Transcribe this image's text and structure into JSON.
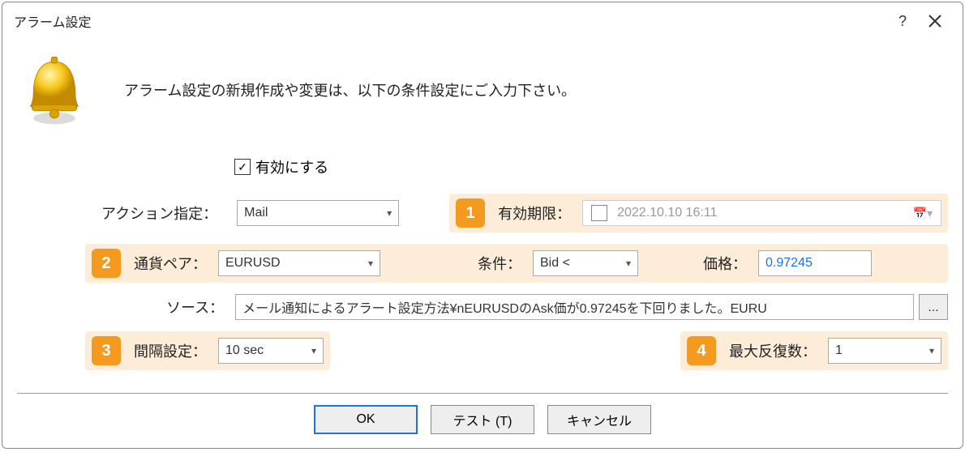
{
  "window": {
    "title": "アラーム設定"
  },
  "intro": "アラーム設定の新規作成や変更は、以下の条件設定にご入力下さい。",
  "enable": {
    "label": "有効にする",
    "checked": true
  },
  "steps": {
    "s1": "1",
    "s2": "2",
    "s3": "3",
    "s4": "4"
  },
  "action": {
    "label": "アクション指定：",
    "value": "Mail"
  },
  "expiry": {
    "label": "有効期限：",
    "value": "2022.10.10 16:11"
  },
  "pair": {
    "label": "通貨ペア：",
    "value": "EURUSD"
  },
  "condition": {
    "label": "条件：",
    "value": "Bid <"
  },
  "price": {
    "label": "価格：",
    "value": "0.97245"
  },
  "source": {
    "label": "ソース：",
    "value": "メール通知によるアラート設定方法¥nEURUSDのAsk価が0.97245を下回りました。EURU"
  },
  "interval": {
    "label": "間隔設定：",
    "value": "10 sec"
  },
  "maxrepeat": {
    "label": "最大反復数：",
    "value": "1"
  },
  "buttons": {
    "ok": "OK",
    "test": "テスト (T)",
    "cancel": "キャンセル"
  },
  "ellipsis": "…"
}
